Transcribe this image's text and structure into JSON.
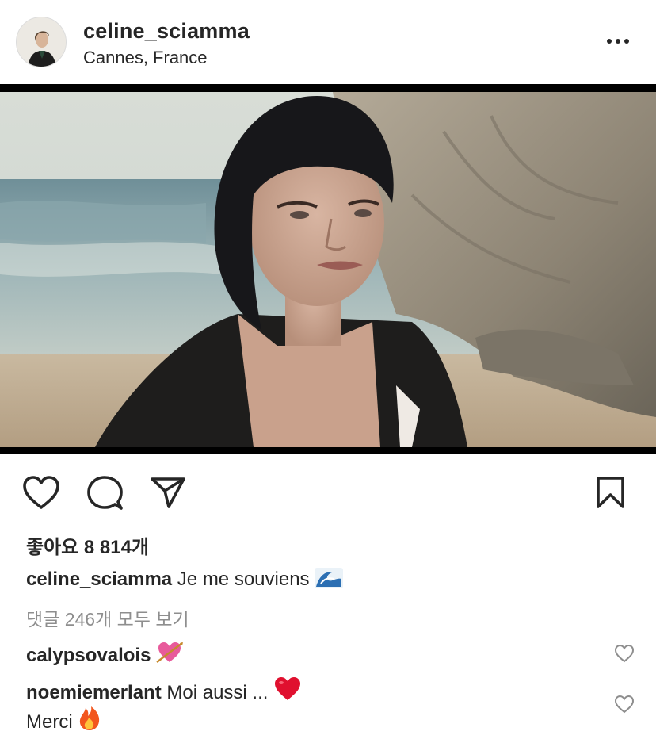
{
  "post": {
    "username": "celine_sciamma",
    "location": "Cannes, France"
  },
  "likes_text": "좋아요 8 814개",
  "caption": {
    "username": "celine_sciamma",
    "text": "Je me souviens",
    "emoji_icon": "wave-emoji-icon"
  },
  "view_all_comments": "댓글 246개 모두 보기",
  "comments": [
    {
      "username": "calypsovalois",
      "text": "",
      "emoji_icon": "heart-with-arrow-emoji-icon"
    },
    {
      "username": "noemiemerlant",
      "text": "Moi aussi ...",
      "emoji_icon": "red-heart-emoji-icon",
      "second_line": "Merci",
      "second_line_emoji_icon": "fire-emoji-icon"
    }
  ],
  "colors": {
    "text": "#262626",
    "secondary_text": "#8e8e8e",
    "heart_red": "#e0102f"
  }
}
